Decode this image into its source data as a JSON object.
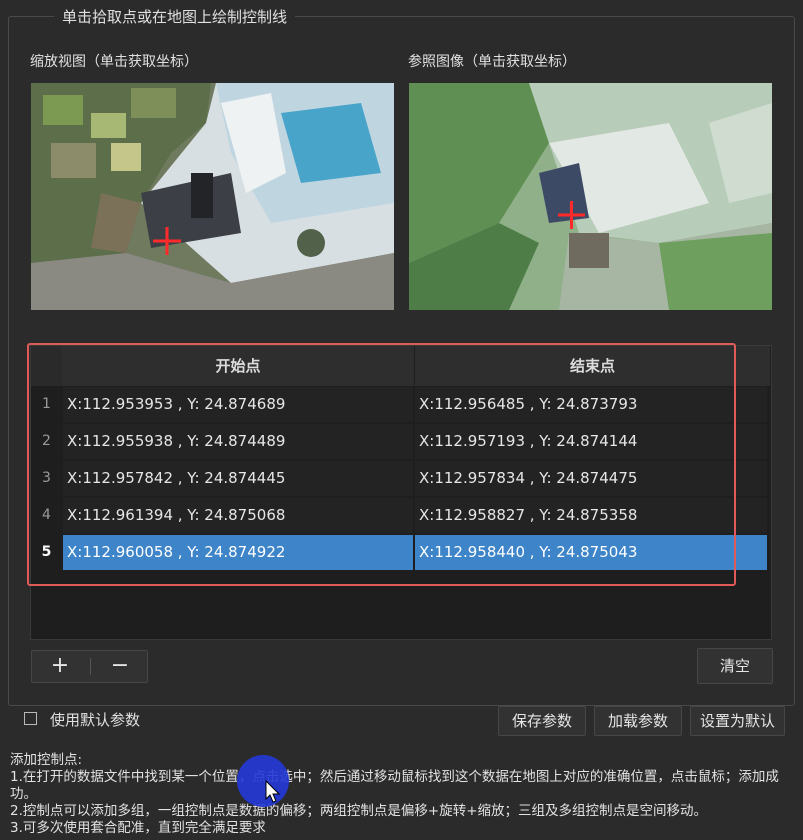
{
  "group": {
    "title": "单击拾取点或在地图上绘制控制线"
  },
  "views": {
    "zoom_label": "缩放视图（单击获取坐标）",
    "ref_label": "参照图像（单击获取坐标）"
  },
  "table": {
    "headers": [
      "开始点",
      "结束点"
    ],
    "rows": [
      {
        "num": "1",
        "start": "X:112.953953 , Y: 24.874689",
        "end": "X:112.956485 , Y: 24.873793"
      },
      {
        "num": "2",
        "start": "X:112.955938 , Y: 24.874489",
        "end": "X:112.957193 , Y: 24.874144"
      },
      {
        "num": "3",
        "start": "X:112.957842 , Y: 24.874445",
        "end": "X:112.957834 , Y: 24.874475"
      },
      {
        "num": "4",
        "start": "X:112.961394 , Y: 24.875068",
        "end": "X:112.958827 , Y: 24.875358"
      },
      {
        "num": "5",
        "start": "X:112.960058 , Y: 24.874922",
        "end": "X:112.958440 , Y: 24.875043"
      }
    ],
    "selected_row": 5
  },
  "buttons": {
    "add": "+",
    "remove": "−",
    "clear": "清空",
    "save": "保存参数",
    "load": "加载参数",
    "default": "设置为默认"
  },
  "checkbox": {
    "label": "使用默认参数",
    "checked": false
  },
  "help": {
    "title": "添加控制点:",
    "line1": "1.在打开的数据文件中找到某一个位置，点击选中；然后通过移动鼠标找到这个数据在地图上对应的准确位置，点击鼠标；添加成功。",
    "line2": "2.控制点可以添加多组，一组控制点是数据的偏移；两组控制点是偏移+旋转+缩放；三组及多组控制点是空间移动。",
    "line3": "3.可多次使用套合配准，直到完全满足要求"
  },
  "colors": {
    "selection": "#3d84c8",
    "highlight_border": "#e15a5a",
    "marker": "#ff2a2a"
  }
}
